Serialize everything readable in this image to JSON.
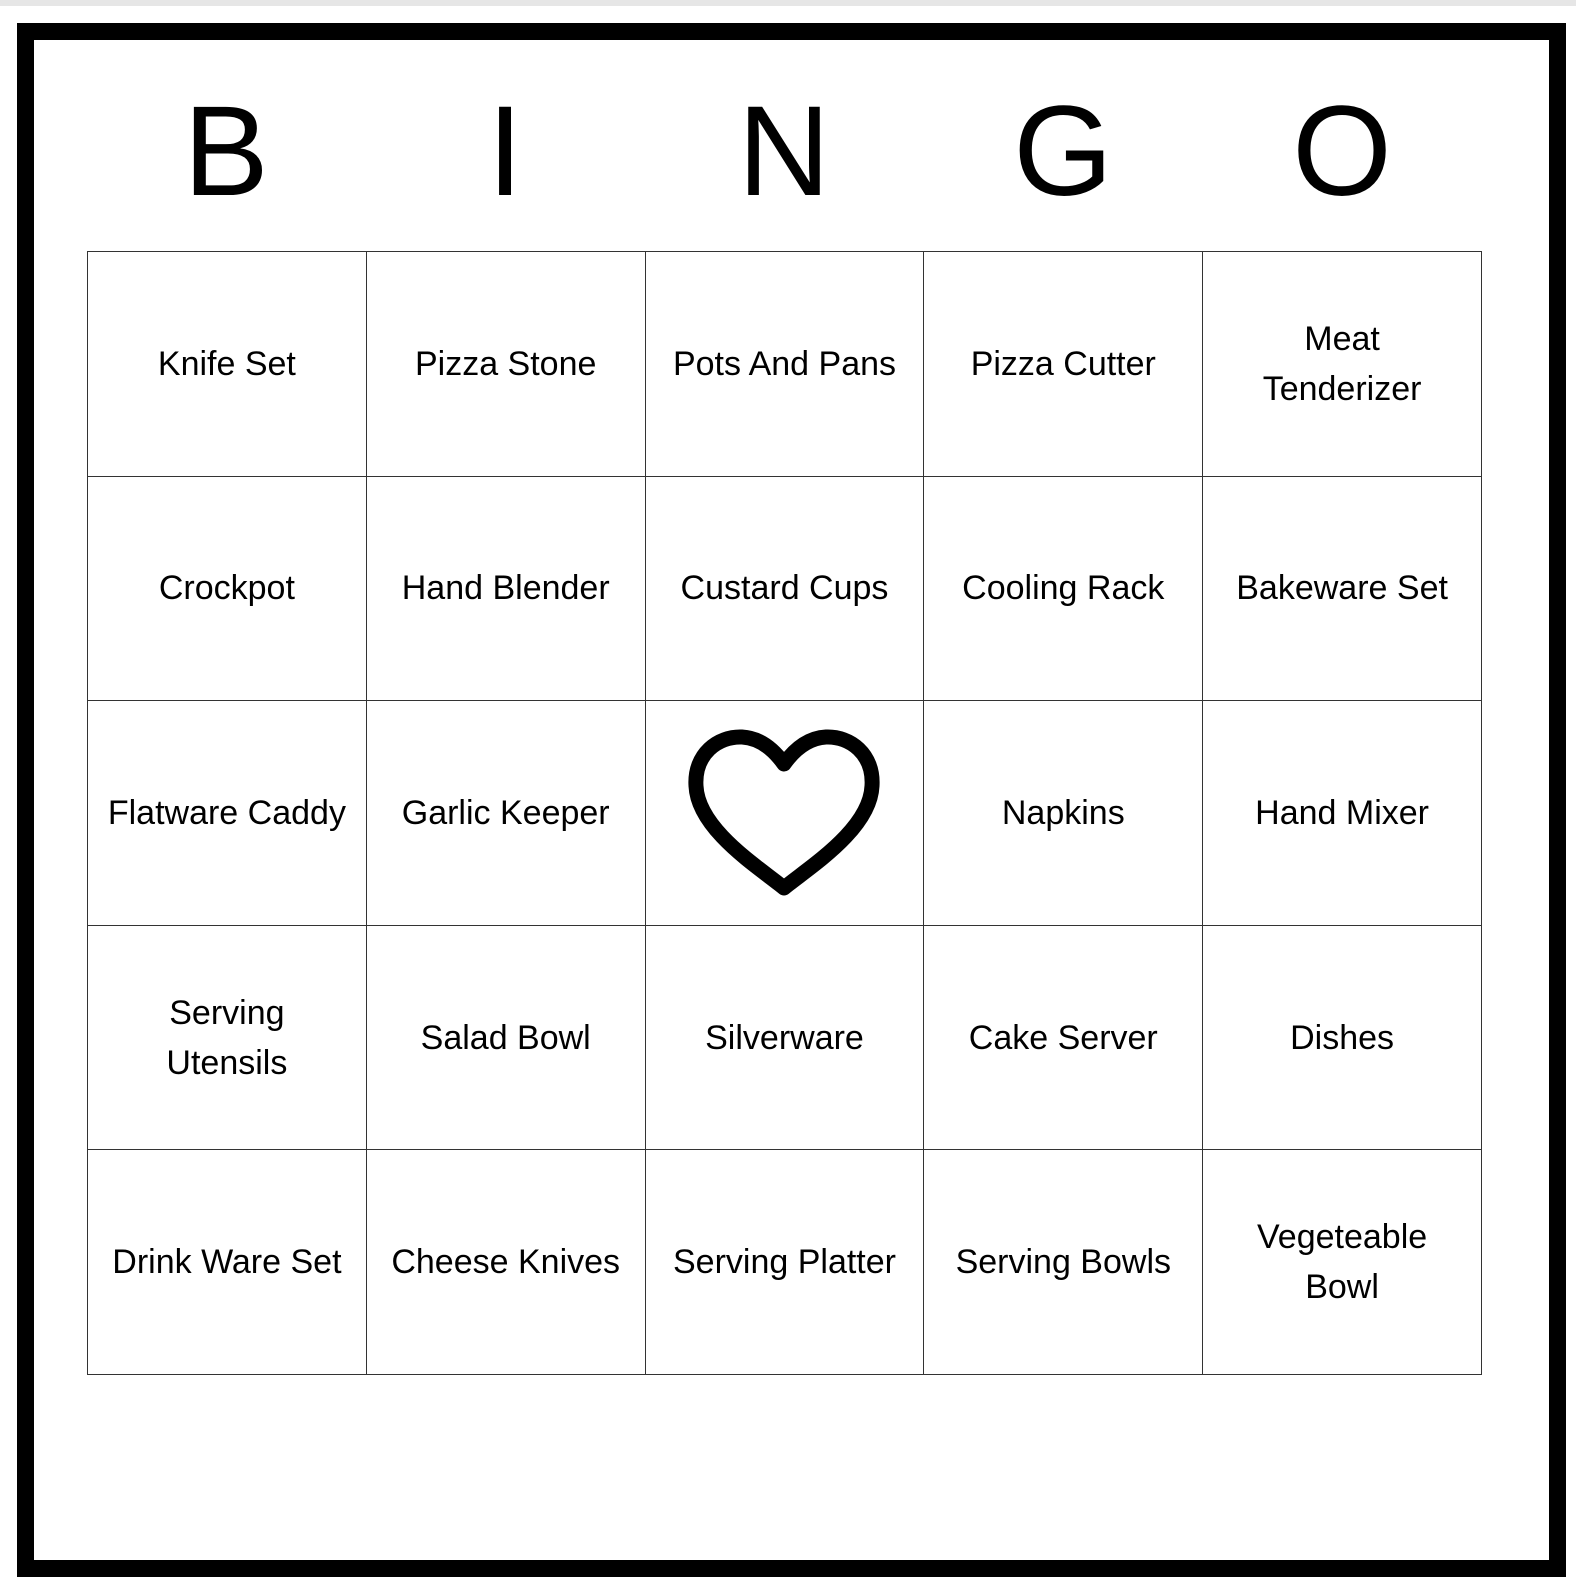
{
  "header": {
    "letters": [
      "B",
      "I",
      "N",
      "G",
      "O"
    ]
  },
  "grid": {
    "cells": [
      "Knife Set",
      "Pizza Stone",
      "Pots And Pans",
      "Pizza Cutter",
      "Meat Tenderizer",
      "Crockpot",
      "Hand Blender",
      "Custard Cups",
      "Cooling Rack",
      "Bakeware Set",
      "Flatware Caddy",
      "Garlic Keeper",
      "",
      "Napkins",
      "Hand Mixer",
      "Serving Utensils",
      "Salad Bowl",
      "Silverware",
      "Cake Server",
      "Dishes",
      "Drink Ware Set",
      "Cheese Knives",
      "Serving Platter",
      "Serving Bowls",
      "Vegeteable Bowl"
    ],
    "free_space_icon": "heart-icon"
  },
  "colors": {
    "ink": "#000000",
    "grid_line": "#333333",
    "background": "#ffffff"
  }
}
